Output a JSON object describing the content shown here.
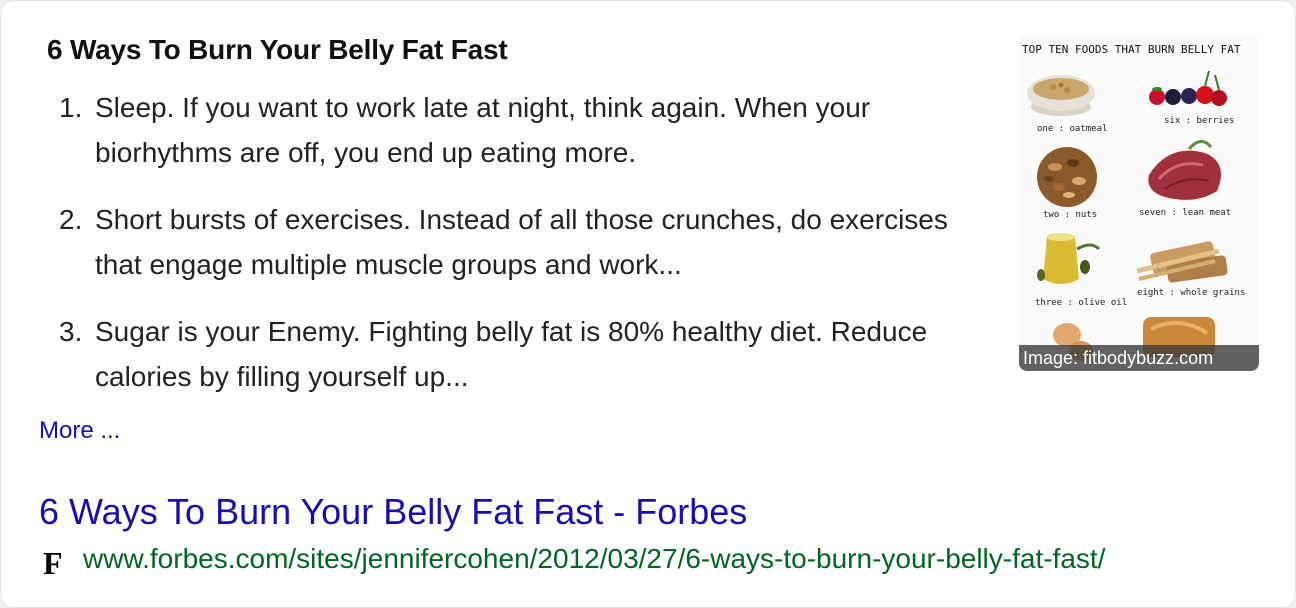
{
  "snippet": {
    "title": "6 Ways To Burn Your Belly Fat Fast",
    "items": [
      {
        "num": "1.",
        "text": "Sleep. If you want to work late at night, think again. When your biorhythms are off, you end up eating more."
      },
      {
        "num": "2.",
        "text": "Short bursts of exercises. Instead of all those crunches, do exercises that engage multiple muscle groups and work..."
      },
      {
        "num": "3.",
        "text": "Sugar is your Enemy. Fighting belly fat is 80% healthy diet. Reduce calories by filling yourself up..."
      }
    ],
    "more_label": "More ..."
  },
  "image": {
    "heading": "TOP TEN FOODS THAT BURN BELLY FAT",
    "labels": {
      "one": "one : oatmeal",
      "six": "six : berries",
      "two": "two : nuts",
      "seven": "seven : lean meat",
      "three": "three : olive oil",
      "eight": "eight : whole grains"
    },
    "caption": "Image: fitbodybuzz.com"
  },
  "result": {
    "title": "6 Ways To Burn Your Belly Fat Fast - Forbes",
    "favicon": "F",
    "url": "www.forbes.com/sites/jennifercohen/2012/03/27/6-ways-to-burn-your-belly-fat-fast/"
  },
  "colors": {
    "link": "#1a0dab",
    "url": "#006621"
  }
}
